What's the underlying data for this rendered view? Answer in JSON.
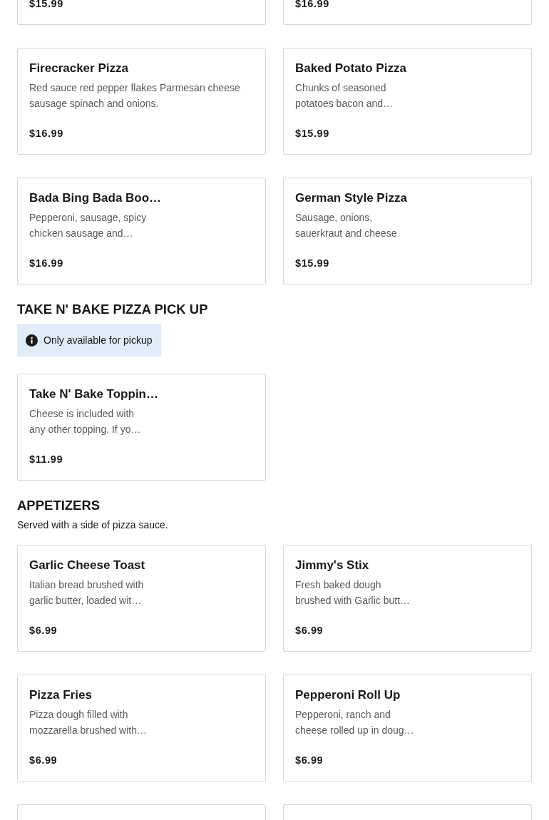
{
  "top_cards": [
    {
      "kind": "cut-off-top",
      "price": "$15.99"
    },
    {
      "kind": "cut-off-top",
      "price": "$16.99"
    }
  ],
  "pizza_cards": [
    {
      "kind": "item",
      "name": "Firecracker Pizza",
      "description": "Red sauce red pepper flakes Parmesan cheese sausage spinach and onions.",
      "price": "$16.99",
      "has_image": false
    },
    {
      "kind": "item",
      "name": "Baked Potato Pizza",
      "description": "Chunks of seasoned potatoes bacon and…",
      "price": "$15.99",
      "has_image": true
    },
    {
      "kind": "item",
      "name": "Bada Bing Bada Boo…",
      "description": "Pepperoni, sausage, spicy chicken sausage and…",
      "price": "$16.99",
      "has_image": true
    },
    {
      "kind": "item",
      "name": "German Style Pizza",
      "description": "Sausage, onions, sauerkraut and cheese",
      "price": "$15.99",
      "has_image": true
    }
  ],
  "sections": [
    {
      "title": "TAKE N' BAKE PIZZA PICK UP",
      "notice": "Only available for pickup",
      "cards": [
        {
          "kind": "item",
          "name": "Take N' Bake Toppin…",
          "description": "Cheese is included with any other topping. If yo…",
          "price": "$11.99",
          "has_image": true
        }
      ]
    },
    {
      "title": "APPETIZERS",
      "subtitle": "Served with a side of pizza sauce.",
      "cards": [
        {
          "kind": "item",
          "name": "Garlic Cheese Toast",
          "description": "Italian bread brushed with garlic butter, loaded wit…",
          "price": "$6.99",
          "has_image": true
        },
        {
          "kind": "item",
          "name": "Jimmy's Stix",
          "description": "Fresh baked dough brushed with Garlic butt…",
          "price": "$6.99",
          "has_image": true
        },
        {
          "kind": "item",
          "name": "Pizza Fries",
          "description": "Pizza dough filled with mozzarella brushed with…",
          "price": "$6.99",
          "has_image": true
        },
        {
          "kind": "item",
          "name": "Pepperoni Roll Up",
          "description": "Pepperoni, ranch and cheese rolled up in doug…",
          "price": "$6.99",
          "has_image": true
        },
        {
          "kind": "cut-off-bottom"
        },
        {
          "kind": "cut-off-bottom"
        }
      ]
    }
  ]
}
